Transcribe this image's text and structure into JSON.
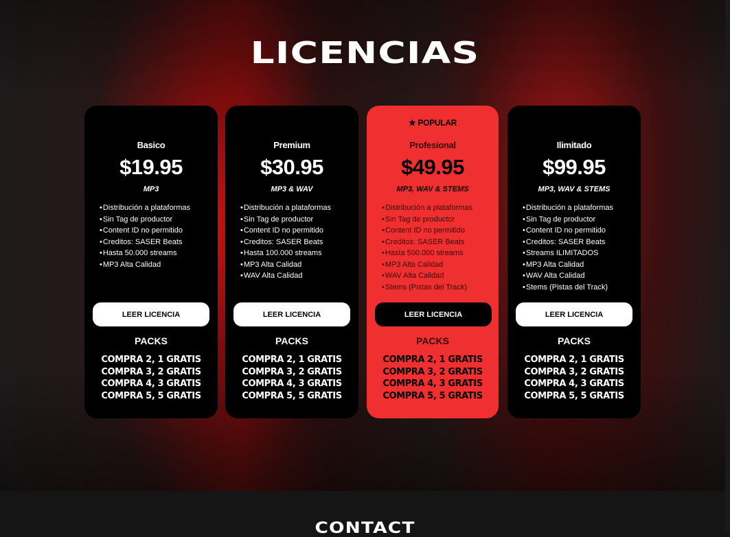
{
  "page": {
    "title": "LICENCIAS",
    "footer_heading": "CONTACT"
  },
  "colors": {
    "card_bg": "#000000",
    "featured_bg": "#f03030",
    "text_light": "#ffffff",
    "button_bg": "#ffffff"
  },
  "plans": [
    {
      "name": "Basico",
      "price": "$19.95",
      "format": "MP3",
      "features": [
        "Distribución a plataformas",
        "Sin Tag de productor",
        "Content ID no permitido",
        "Creditos: SASER Beats",
        "Hasta 50.000 streams",
        "MP3 Alta Calidad"
      ],
      "button_label": "LEER LICENCIA",
      "packs_title": "PACKS",
      "packs": [
        "COMPRA 2, 1 GRATIS",
        "COMPRA 3, 2 GRATIS",
        "COMPRA 4, 3 GRATIS",
        "COMPRA 5, 5 GRATIS"
      ]
    },
    {
      "name": "Premium",
      "price": "$30.95",
      "format": "MP3 & WAV",
      "features": [
        "Distribución a plataformas",
        "Sin Tag de productor",
        "Content ID no permitido",
        "Creditos: SASER Beats",
        "Hasta 100.000 streams",
        "MP3 Alta Calidad",
        "WAV Alta Calidad"
      ],
      "button_label": "LEER LICENCIA",
      "packs_title": "PACKS",
      "packs": [
        "COMPRA 2, 1 GRATIS",
        "COMPRA 3, 2 GRATIS",
        "COMPRA 4, 3 GRATIS",
        "COMPRA 5, 5 GRATIS"
      ]
    },
    {
      "badge": "★ POPULAR",
      "name": "Profesional",
      "price": "$49.95",
      "format": "MP3, WAV & STEMS",
      "features": [
        "Distribución a plataformas",
        "Sin Tag de productor",
        "Content ID no permitido",
        "Creditos: SASER Beats",
        "Hasta 500.000 streams",
        "MP3 Alta Calidad",
        "WAV Alta Calidad",
        "Stems (Pistas del Track)"
      ],
      "button_label": "LEER LICENCIA",
      "packs_title": "PACKS",
      "packs": [
        "COMPRA 2, 1 GRATIS",
        "COMPRA 3, 2 GRATIS",
        "COMPRA 4, 3 GRATIS",
        "COMPRA 5, 5 GRATIS"
      ]
    },
    {
      "name": "Ilimitado",
      "price": "$99.95",
      "format": "MP3, WAV & STEMS",
      "features": [
        "Distribución a plataformas",
        "Sin Tag de productor",
        "Content ID no permitido",
        "Creditos: SASER Beats",
        "Streams ILIMITADOS",
        "MP3 Alta Calidad",
        "WAV Alta Calidad",
        "Stems (Pistas del Track)"
      ],
      "button_label": "LEER LICENCIA",
      "packs_title": "PACKS",
      "packs": [
        "COMPRA 2, 1 GRATIS",
        "COMPRA 3, 2 GRATIS",
        "COMPRA 4, 3 GRATIS",
        "COMPRA 5, 5 GRATIS"
      ]
    }
  ]
}
